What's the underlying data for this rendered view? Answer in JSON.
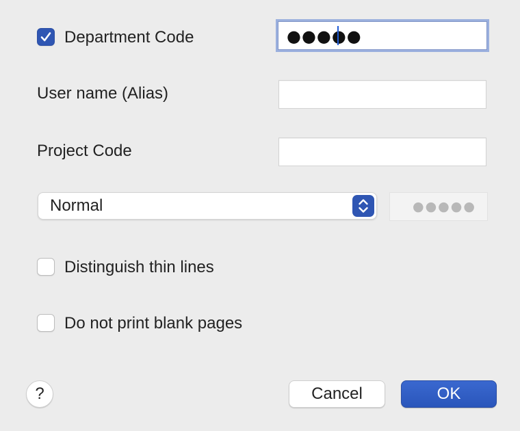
{
  "department_code": {
    "label": "Department Code",
    "checked": true,
    "masked_value": "●●●●●"
  },
  "user_name": {
    "label": "User name (Alias)",
    "value": ""
  },
  "project_code": {
    "label": "Project Code",
    "value": ""
  },
  "print_mode": {
    "selected": "Normal",
    "password_masked": "●●●●●"
  },
  "distinguish_thin_lines": {
    "label": "Distinguish thin lines",
    "checked": false
  },
  "skip_blank_pages": {
    "label": "Do not print blank pages",
    "checked": false
  },
  "buttons": {
    "help": "?",
    "cancel": "Cancel",
    "ok": "OK"
  },
  "colors": {
    "accent": "#2f56b3",
    "focus_ring": "#9bb0de",
    "background": "#ececec"
  }
}
